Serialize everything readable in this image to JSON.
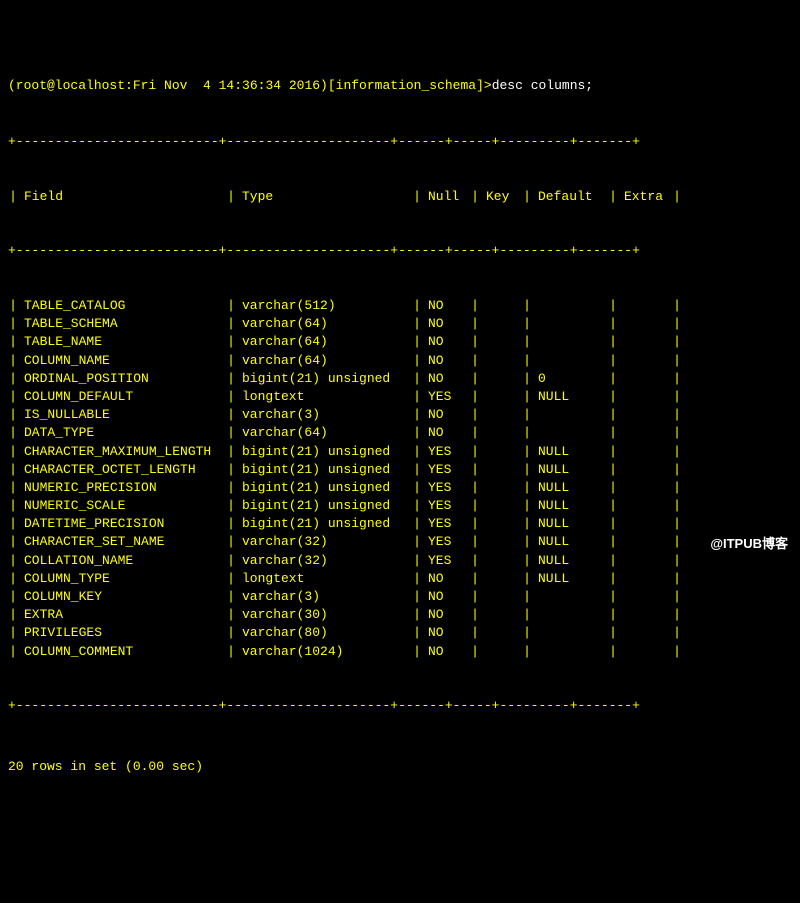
{
  "prompt": {
    "user_host_time": "(root@localhost:Fri Nov  4 14:36:34 2016)[information_schema]>",
    "command": "desc columns;"
  },
  "table": {
    "headers": {
      "field": "Field",
      "type": "Type",
      "null": "Null",
      "key": "Key",
      "default": "Default",
      "extra": "Extra"
    },
    "rows": [
      {
        "field": "TABLE_CATALOG",
        "type": "varchar(512)",
        "null": "NO",
        "key": "",
        "default": "",
        "extra": ""
      },
      {
        "field": "TABLE_SCHEMA",
        "type": "varchar(64)",
        "null": "NO",
        "key": "",
        "default": "",
        "extra": ""
      },
      {
        "field": "TABLE_NAME",
        "type": "varchar(64)",
        "null": "NO",
        "key": "",
        "default": "",
        "extra": ""
      },
      {
        "field": "COLUMN_NAME",
        "type": "varchar(64)",
        "null": "NO",
        "key": "",
        "default": "",
        "extra": ""
      },
      {
        "field": "ORDINAL_POSITION",
        "type": "bigint(21) unsigned",
        "null": "NO",
        "key": "",
        "default": "0",
        "extra": ""
      },
      {
        "field": "COLUMN_DEFAULT",
        "type": "longtext",
        "null": "YES",
        "key": "",
        "default": "NULL",
        "extra": ""
      },
      {
        "field": "IS_NULLABLE",
        "type": "varchar(3)",
        "null": "NO",
        "key": "",
        "default": "",
        "extra": ""
      },
      {
        "field": "DATA_TYPE",
        "type": "varchar(64)",
        "null": "NO",
        "key": "",
        "default": "",
        "extra": ""
      },
      {
        "field": "CHARACTER_MAXIMUM_LENGTH",
        "type": "bigint(21) unsigned",
        "null": "YES",
        "key": "",
        "default": "NULL",
        "extra": ""
      },
      {
        "field": "CHARACTER_OCTET_LENGTH",
        "type": "bigint(21) unsigned",
        "null": "YES",
        "key": "",
        "default": "NULL",
        "extra": ""
      },
      {
        "field": "NUMERIC_PRECISION",
        "type": "bigint(21) unsigned",
        "null": "YES",
        "key": "",
        "default": "NULL",
        "extra": ""
      },
      {
        "field": "NUMERIC_SCALE",
        "type": "bigint(21) unsigned",
        "null": "YES",
        "key": "",
        "default": "NULL",
        "extra": ""
      },
      {
        "field": "DATETIME_PRECISION",
        "type": "bigint(21) unsigned",
        "null": "YES",
        "key": "",
        "default": "NULL",
        "extra": ""
      },
      {
        "field": "CHARACTER_SET_NAME",
        "type": "varchar(32)",
        "null": "YES",
        "key": "",
        "default": "NULL",
        "extra": ""
      },
      {
        "field": "COLLATION_NAME",
        "type": "varchar(32)",
        "null": "YES",
        "key": "",
        "default": "NULL",
        "extra": ""
      },
      {
        "field": "COLUMN_TYPE",
        "type": "longtext",
        "null": "NO",
        "key": "",
        "default": "NULL",
        "extra": ""
      },
      {
        "field": "COLUMN_KEY",
        "type": "varchar(3)",
        "null": "NO",
        "key": "",
        "default": "",
        "extra": ""
      },
      {
        "field": "EXTRA",
        "type": "varchar(30)",
        "null": "NO",
        "key": "",
        "default": "",
        "extra": ""
      },
      {
        "field": "PRIVILEGES",
        "type": "varchar(80)",
        "null": "NO",
        "key": "",
        "default": "",
        "extra": ""
      },
      {
        "field": "COLUMN_COMMENT",
        "type": "varchar(1024)",
        "null": "NO",
        "key": "",
        "default": "",
        "extra": ""
      }
    ]
  },
  "footer": "20 rows in set (0.00 sec)",
  "watermark": "@ITPUB博客",
  "border": "+--------------------------+---------------------+------+-----+---------+-------+"
}
